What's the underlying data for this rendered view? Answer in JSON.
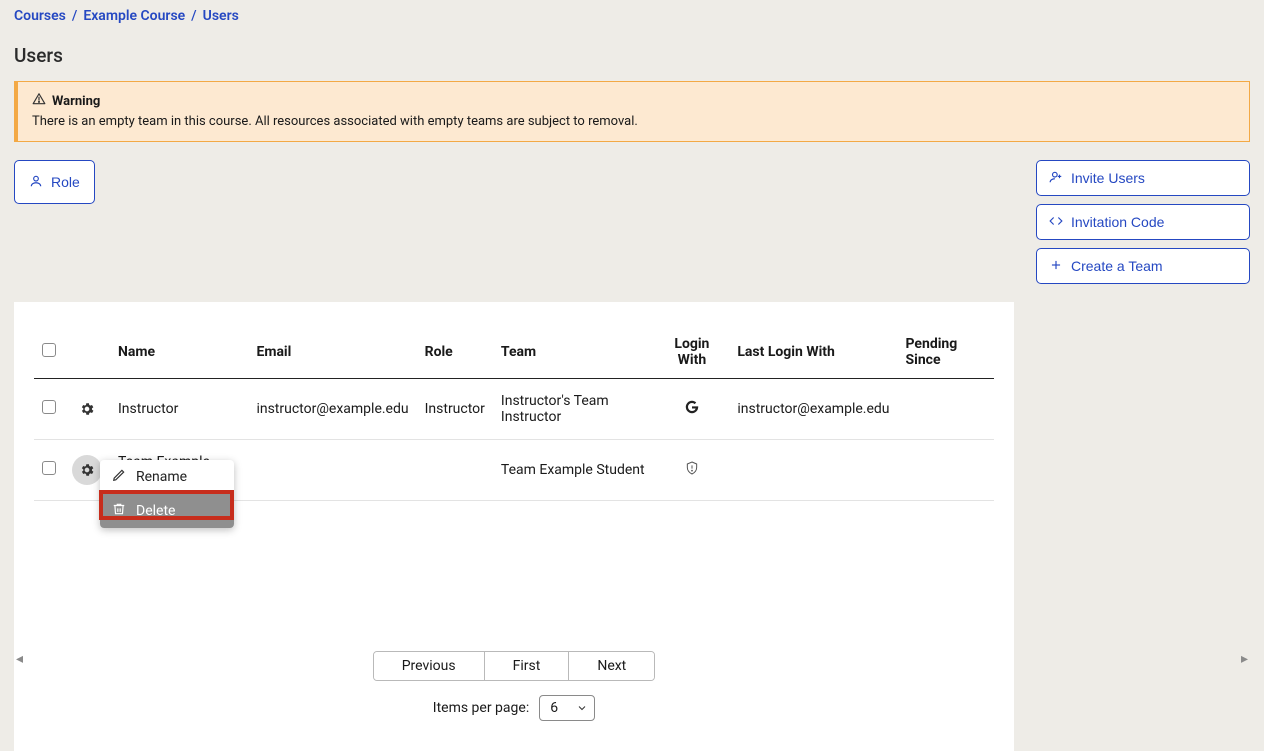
{
  "breadcrumb": {
    "items": [
      "Courses",
      "Example Course",
      "Users"
    ]
  },
  "page_title": "Users",
  "warning": {
    "label": "Warning",
    "message": "There is an empty team in this course. All resources associated with empty teams are subject to removal."
  },
  "role_button_label": "Role",
  "action_buttons": {
    "invite_users": "Invite Users",
    "invitation_code": "Invitation Code",
    "create_team": "Create a Team"
  },
  "table": {
    "headers": {
      "name": "Name",
      "email": "Email",
      "role": "Role",
      "team": "Team",
      "login_with": "Login With",
      "last_login_with": "Last Login With",
      "pending_since": "Pending Since"
    },
    "rows": [
      {
        "name": "Instructor",
        "email": "instructor@example.edu",
        "role": "Instructor",
        "team": "Instructor's Team Instructor",
        "login_with_icon": "google",
        "last_login_with": "instructor@example.edu",
        "pending_since": "",
        "gear_active": false
      },
      {
        "name": "Team Example Student",
        "email": "",
        "role": "",
        "team": "Team Example Student",
        "login_with_icon": "shield",
        "last_login_with": "",
        "pending_since": "",
        "gear_active": true
      }
    ]
  },
  "context_menu": {
    "rename": "Rename",
    "delete": "Delete"
  },
  "pagination": {
    "previous": "Previous",
    "first": "First",
    "next": "Next",
    "items_per_page_label": "Items per page:",
    "items_per_page_value": "6"
  }
}
